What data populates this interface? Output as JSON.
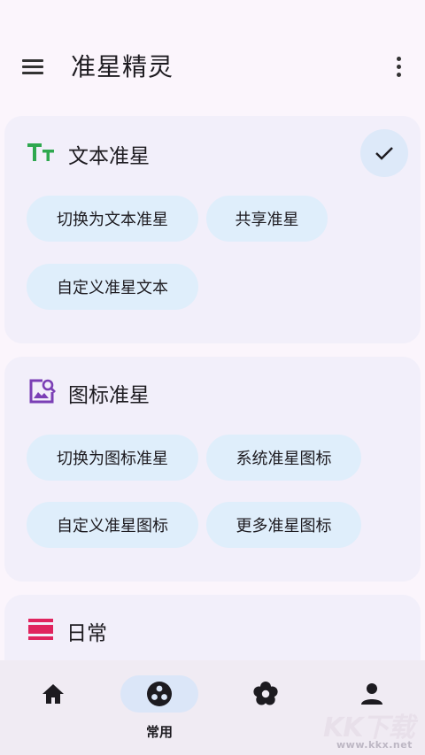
{
  "app": {
    "title": "准星精灵",
    "menu_icon": "hamburger-menu-icon",
    "more_icon": "more-vert-icon"
  },
  "sections": {
    "text_crosshair": {
      "title": "文本准星",
      "icon": "text-fields-icon",
      "icon_color": "#2fa84f",
      "selected": true,
      "chips": [
        "切换为文本准星",
        "共享准星",
        "自定义准星文本"
      ]
    },
    "icon_crosshair": {
      "title": "图标准星",
      "icon": "image-search-icon",
      "icon_color": "#7b3fb5",
      "chips": [
        "切换为图标准星",
        "系统准星图标",
        "自定义准星图标",
        "更多准星图标"
      ]
    },
    "daily": {
      "title": "日常",
      "icon": "view-agenda-icon",
      "icon_color": "#e0245e"
    }
  },
  "bottom_nav": {
    "items": [
      {
        "label": "",
        "icon": "home-icon"
      },
      {
        "label": "常用",
        "icon": "crosshair-dots-icon",
        "active": true
      },
      {
        "label": "",
        "icon": "flower-settings-icon"
      },
      {
        "label": "",
        "icon": "person-icon"
      }
    ]
  },
  "watermark": {
    "text": "KK下载",
    "url_text": "www.kkx.net"
  },
  "colors": {
    "background": "#fbf5fc",
    "card": "#f2effa",
    "chip": "#dfeefb",
    "nav_active": "#dbe6f8",
    "bottom_bar": "#f0ebf3"
  }
}
